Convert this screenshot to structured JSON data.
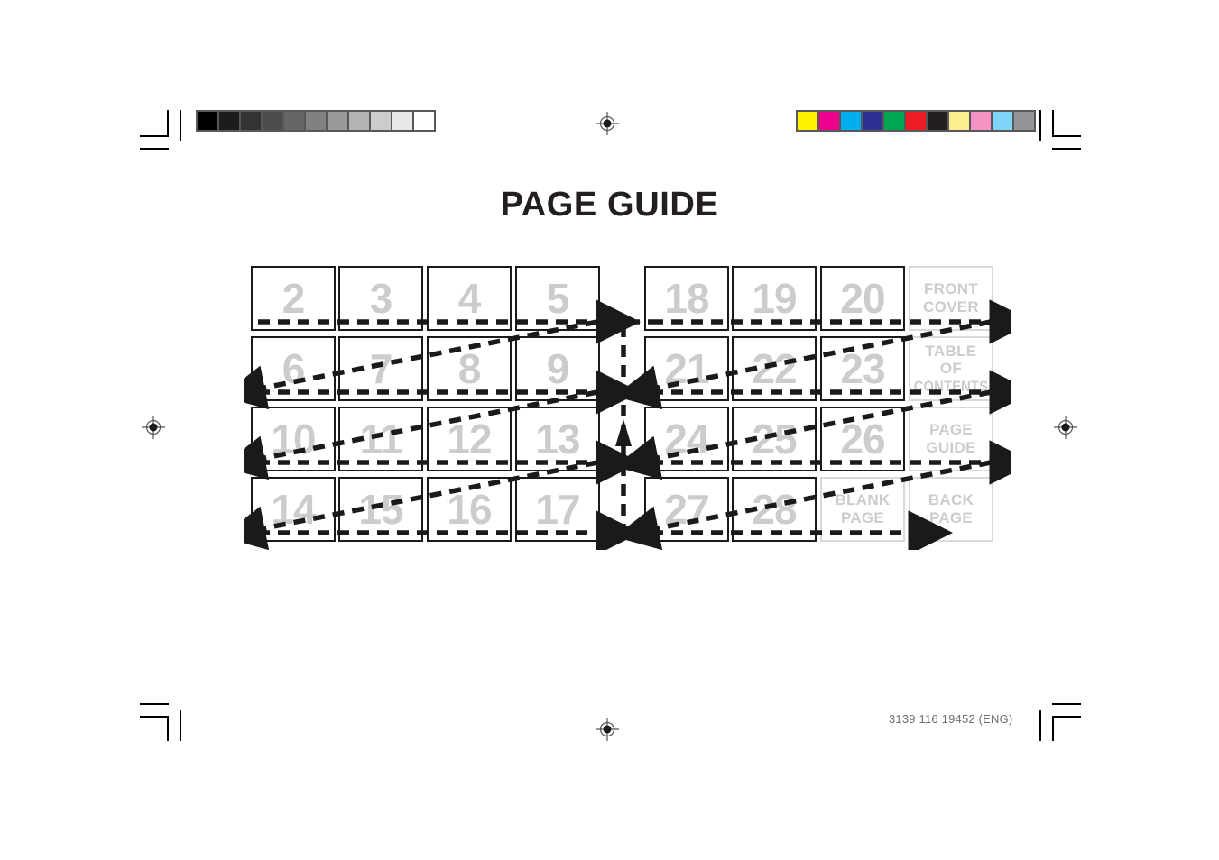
{
  "document": {
    "title": "PAGE GUIDE",
    "footer_code": "3139 116 19452 (ENG)"
  },
  "calibration": {
    "grayscale_bar": {
      "name": "grayscale-step-wedge",
      "frame_color": "#58585a",
      "steps": [
        "#000000",
        "#1c1c1c",
        "#333333",
        "#4d4d4d",
        "#666666",
        "#808080",
        "#999999",
        "#b3b3b3",
        "#cccccc",
        "#e8e8e8",
        "#ffffff"
      ]
    },
    "color_bar": {
      "name": "process-color-bar",
      "frame_color": "#58585a",
      "steps": [
        "#fff200",
        "#ec008c",
        "#00aeef",
        "#2e3192",
        "#00a651",
        "#ed1c24",
        "#231f20",
        "#fcee8f",
        "#f692c4",
        "#7fd4f7",
        "#939598"
      ]
    }
  },
  "guide": {
    "left_grid": {
      "rows": [
        [
          {
            "text": "2",
            "type": "number"
          },
          {
            "text": "3",
            "type": "number"
          },
          {
            "text": "4",
            "type": "number"
          },
          {
            "text": "5",
            "type": "number"
          }
        ],
        [
          {
            "text": "6",
            "type": "number"
          },
          {
            "text": "7",
            "type": "number"
          },
          {
            "text": "8",
            "type": "number"
          },
          {
            "text": "9",
            "type": "number"
          }
        ],
        [
          {
            "text": "10",
            "type": "number"
          },
          {
            "text": "11",
            "type": "number"
          },
          {
            "text": "12",
            "type": "number"
          },
          {
            "text": "13",
            "type": "number"
          }
        ],
        [
          {
            "text": "14",
            "type": "number"
          },
          {
            "text": "15",
            "type": "number"
          },
          {
            "text": "16",
            "type": "number"
          },
          {
            "text": "17",
            "type": "number"
          }
        ]
      ]
    },
    "right_grid": {
      "rows": [
        [
          {
            "text": "18",
            "type": "number"
          },
          {
            "text": "19",
            "type": "number"
          },
          {
            "text": "20",
            "type": "number"
          },
          {
            "lines": [
              "FRONT",
              "COVER"
            ],
            "type": "label"
          }
        ],
        [
          {
            "text": "21",
            "type": "number"
          },
          {
            "text": "22",
            "type": "number"
          },
          {
            "text": "23",
            "type": "number"
          },
          {
            "lines": [
              "TABLE",
              "OF",
              "CONTENTS"
            ],
            "type": "label",
            "condense_last": true
          }
        ],
        [
          {
            "text": "24",
            "type": "number"
          },
          {
            "text": "25",
            "type": "number"
          },
          {
            "text": "26",
            "type": "number"
          },
          {
            "lines": [
              "PAGE",
              "GUIDE"
            ],
            "type": "label"
          }
        ],
        [
          {
            "text": "27",
            "type": "number"
          },
          {
            "text": "28",
            "type": "number"
          },
          {
            "lines": [
              "BLANK",
              "PAGE"
            ],
            "type": "label"
          },
          {
            "lines": [
              "BACK",
              "PAGE"
            ],
            "type": "label"
          }
        ]
      ]
    },
    "flow": {
      "description": "Reading order flows left to right along each row, wraps back to the row below, continues through both page blocks, linked by a vertical return arrow between blocks.",
      "stroke_color": "#1a1a1a"
    }
  }
}
